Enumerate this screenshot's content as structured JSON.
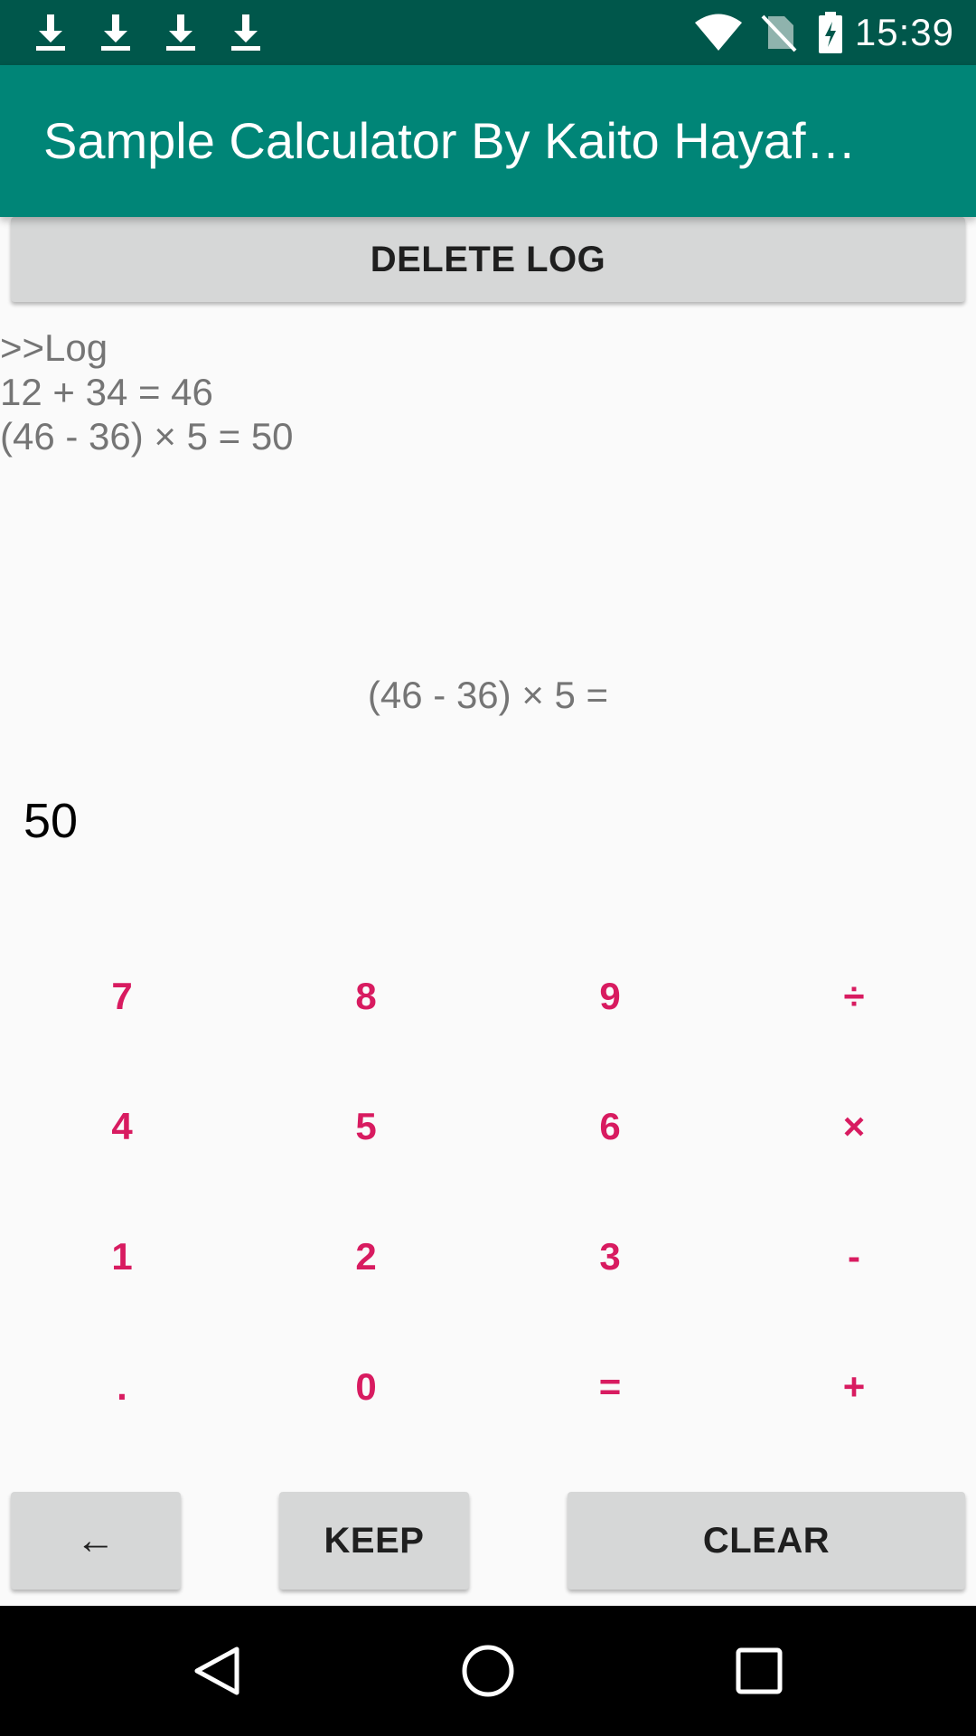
{
  "status_bar": {
    "time": "15:39",
    "icons": [
      "download-icon",
      "download-icon",
      "download-icon",
      "download-icon",
      "wifi-icon",
      "no-sim-icon",
      "battery-charging-icon"
    ]
  },
  "app_bar": {
    "title": "Sample Calculator By Kaito Hayaf…"
  },
  "delete_log_button": "DELETE LOG",
  "log": {
    "header": ">>Log",
    "entries": [
      "12 + 34 = 46",
      "(46 - 36) × 5 = 50"
    ]
  },
  "display": {
    "expression": "(46 - 36) × 5 =",
    "result": "50"
  },
  "keypad": {
    "rows": [
      [
        "7",
        "8",
        "9",
        "÷"
      ],
      [
        "4",
        "5",
        "6",
        "×"
      ],
      [
        "1",
        "2",
        "3",
        "-"
      ],
      [
        ".",
        "0",
        "=",
        "+"
      ]
    ]
  },
  "bottom_buttons": {
    "back": "←",
    "keep": "KEEP",
    "clear": "CLEAR"
  },
  "nav_bar": {
    "icons": [
      "back-icon",
      "home-icon",
      "recents-icon"
    ]
  },
  "colors": {
    "status_bar": "#00574b",
    "app_bar": "#008577",
    "accent": "#d81b60",
    "button": "#d6d7d7",
    "background": "#fafafa"
  }
}
